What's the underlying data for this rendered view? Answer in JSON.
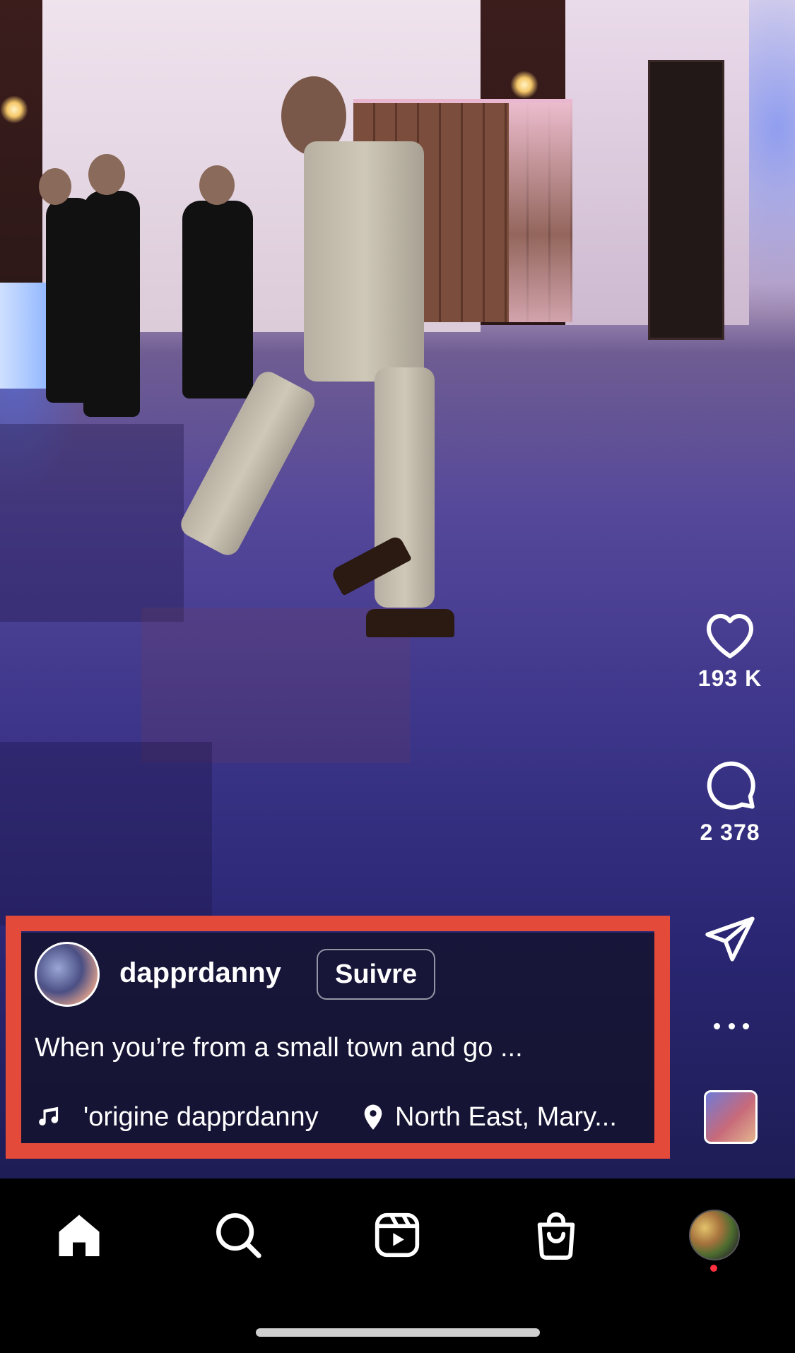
{
  "post": {
    "username": "dapprdanny",
    "follow_label": "Suivre",
    "caption": "When you’re from a small town and go ...",
    "audio": "'origine  dapprdanny",
    "location": "North East, Mary..."
  },
  "actions": {
    "likes": "193 K",
    "comments": "2 378"
  },
  "icons": {
    "like": "heart-icon",
    "comment": "comment-icon",
    "share": "send-icon",
    "more": "more-icon",
    "music": "music-note-icon",
    "location": "location-pin-icon",
    "nav": [
      "home-icon",
      "search-icon",
      "reels-icon",
      "shop-icon",
      "profile-icon"
    ]
  },
  "colors": {
    "highlight": "#e34a3a",
    "notification_dot": "#ff3040"
  }
}
